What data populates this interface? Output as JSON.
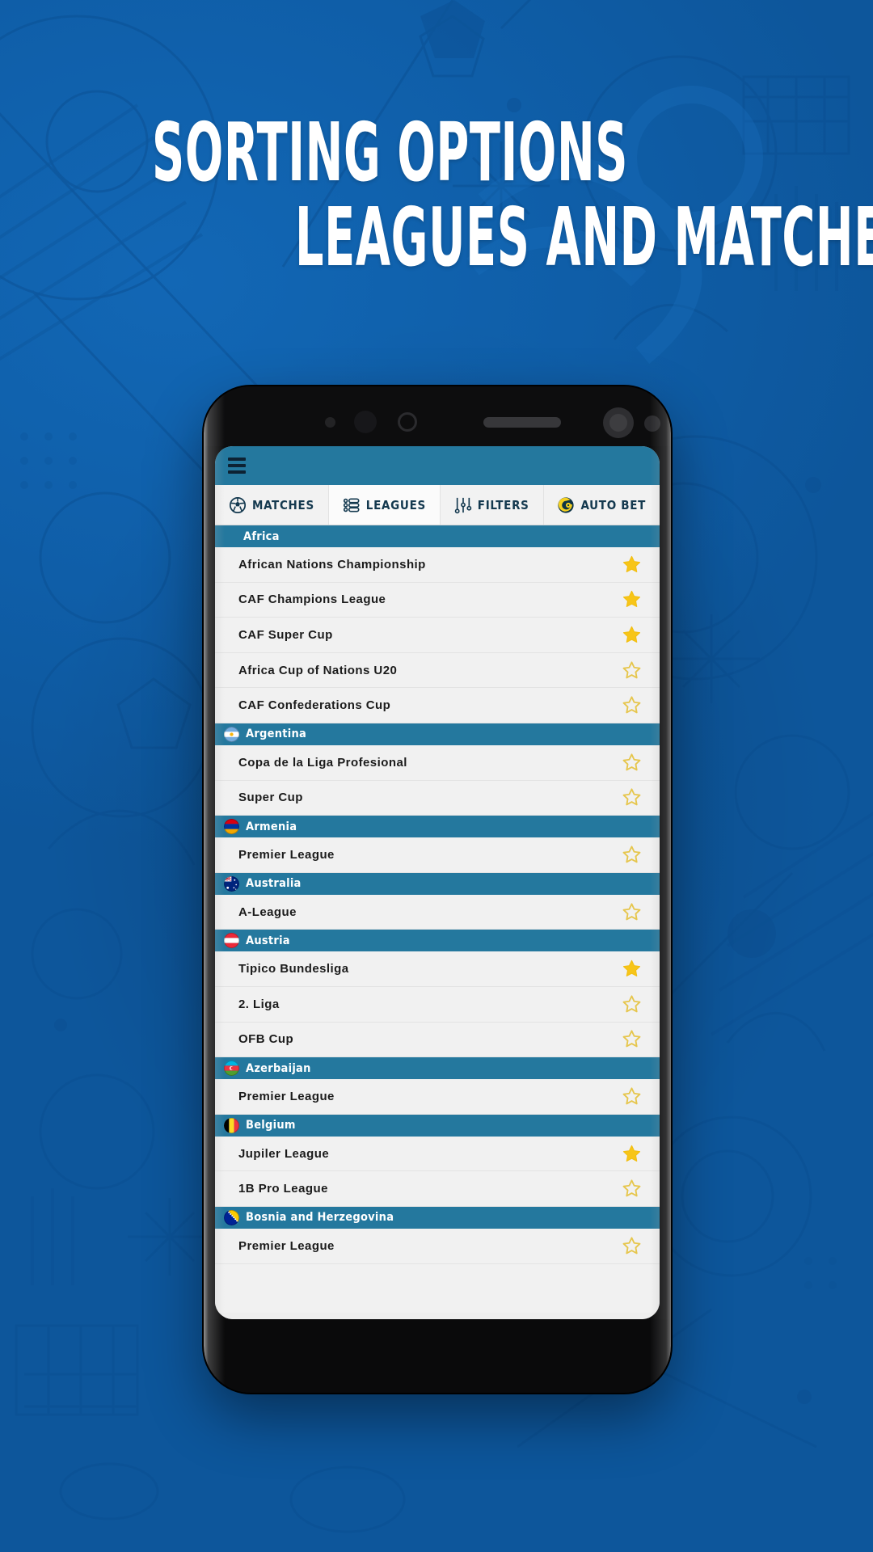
{
  "promo": {
    "headline_line1": "SORTING OPTIONS",
    "headline_line2": "LEAGUES AND MATCHES"
  },
  "colors": {
    "background_blue": "#0f5ea8",
    "header_teal": "#24789e",
    "star_filled": "#f7c518",
    "star_empty": "#e8c54a",
    "row_bg": "#f1f1f1",
    "text_dark": "#1b1b1b",
    "autobet_yellow": "#f5d020",
    "autobet_navy": "#0d3345"
  },
  "app": {
    "header": {
      "menu_icon": "hamburger-menu-icon"
    },
    "tabs": [
      {
        "label": "MATCHES",
        "icon": "soccer-ball-icon",
        "active": false
      },
      {
        "label": "LEAGUES",
        "icon": "list-lines-icon",
        "active": true
      },
      {
        "label": "FILTERS",
        "icon": "sliders-icon",
        "active": false
      },
      {
        "label": "AUTO BET",
        "icon": "go-logo-icon",
        "active": false
      }
    ],
    "groups": [
      {
        "country": "Africa",
        "flag": "none",
        "leagues": [
          {
            "name": "African Nations Championship",
            "favorite": true
          },
          {
            "name": "CAF Champions League",
            "favorite": true
          },
          {
            "name": "CAF Super Cup",
            "favorite": true
          },
          {
            "name": "Africa Cup of Nations U20",
            "favorite": false
          },
          {
            "name": "CAF Confederations Cup",
            "favorite": false
          }
        ]
      },
      {
        "country": "Argentina",
        "flag": "ar",
        "leagues": [
          {
            "name": "Copa de la Liga Profesional",
            "favorite": false
          },
          {
            "name": "Super Cup",
            "favorite": false
          }
        ]
      },
      {
        "country": "Armenia",
        "flag": "am",
        "leagues": [
          {
            "name": "Premier League",
            "favorite": false
          }
        ]
      },
      {
        "country": "Australia",
        "flag": "au",
        "leagues": [
          {
            "name": "A-League",
            "favorite": false
          }
        ]
      },
      {
        "country": "Austria",
        "flag": "at",
        "leagues": [
          {
            "name": "Tipico Bundesliga",
            "favorite": true
          },
          {
            "name": "2. Liga",
            "favorite": false
          },
          {
            "name": "OFB Cup",
            "favorite": false
          }
        ]
      },
      {
        "country": "Azerbaijan",
        "flag": "az",
        "leagues": [
          {
            "name": "Premier League",
            "favorite": false
          }
        ]
      },
      {
        "country": "Belgium",
        "flag": "be",
        "leagues": [
          {
            "name": "Jupiler League",
            "favorite": true
          },
          {
            "name": "1B Pro League",
            "favorite": false
          }
        ]
      },
      {
        "country": "Bosnia and Herzegovina",
        "flag": "ba",
        "leagues": [
          {
            "name": "Premier League",
            "favorite": false
          }
        ]
      }
    ]
  }
}
